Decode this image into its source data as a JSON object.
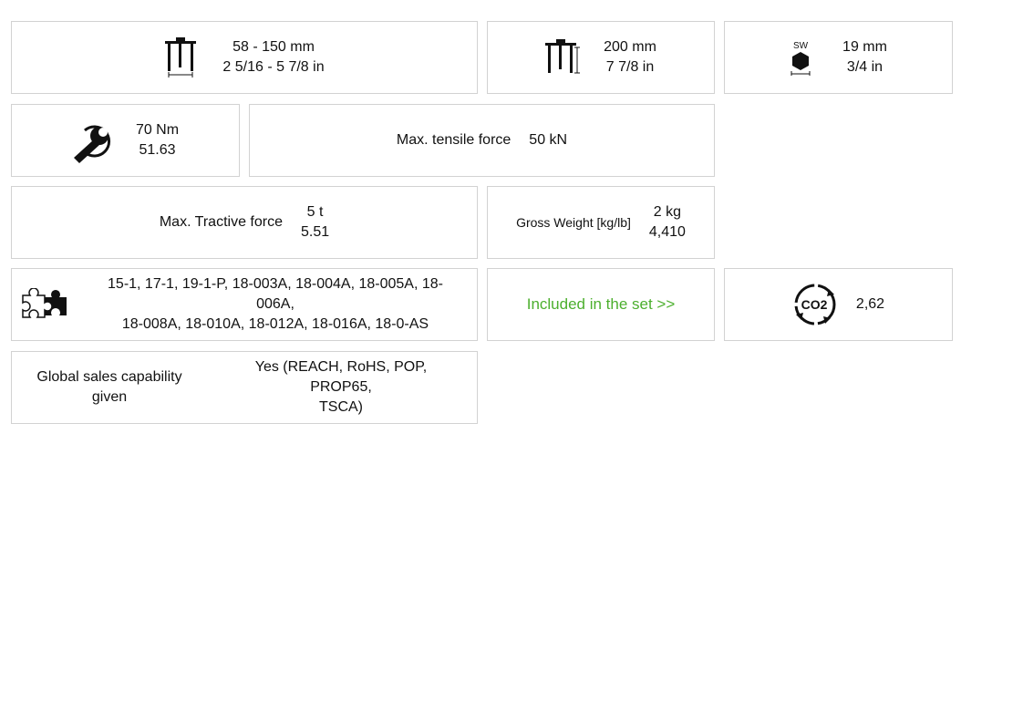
{
  "spread": {
    "value_mm": "58 - 150 mm",
    "value_in": "2 5/16 - 5 7/8 in",
    "icon": "puller-spread-icon"
  },
  "depth": {
    "value_mm": "200 mm",
    "value_in": "7 7/8 in",
    "icon": "puller-depth-icon"
  },
  "wrench_size": {
    "icon_text": "SW",
    "value_mm": "19 mm",
    "value_in": "3/4 in",
    "icon": "hex-nut-icon"
  },
  "torque": {
    "value_nm": "70 Nm",
    "value_alt": "51.63",
    "icon": "torque-wrench-icon"
  },
  "tensile": {
    "label": "Max. tensile force",
    "value": "50 kN"
  },
  "tractive": {
    "label": "Max. Tractive force",
    "value_t": "5 t",
    "value_alt": "5.51"
  },
  "weight": {
    "label": "Gross Weight [kg/lb]",
    "value_kg": "2 kg",
    "value_lb": "4,410"
  },
  "compatible": {
    "icon": "puzzle-icon",
    "line1": "15-1, 17-1, 19-1-P, 18-003A, 18-004A, 18-005A, 18-006A,",
    "line2": "18-008A, 18-010A, 18-012A, 18-016A, 18-0-AS"
  },
  "included": {
    "link_text": "Included in the set >>",
    "color": "#4caf2e"
  },
  "co2": {
    "icon_text": "CO2",
    "value": "2,62",
    "icon": "co2-cycle-icon"
  },
  "global_sales": {
    "label_line1": "Global sales capability",
    "label_line2": "given",
    "value_line1": "Yes (REACH, RoHS, POP, PROP65,",
    "value_line2": "TSCA)"
  }
}
